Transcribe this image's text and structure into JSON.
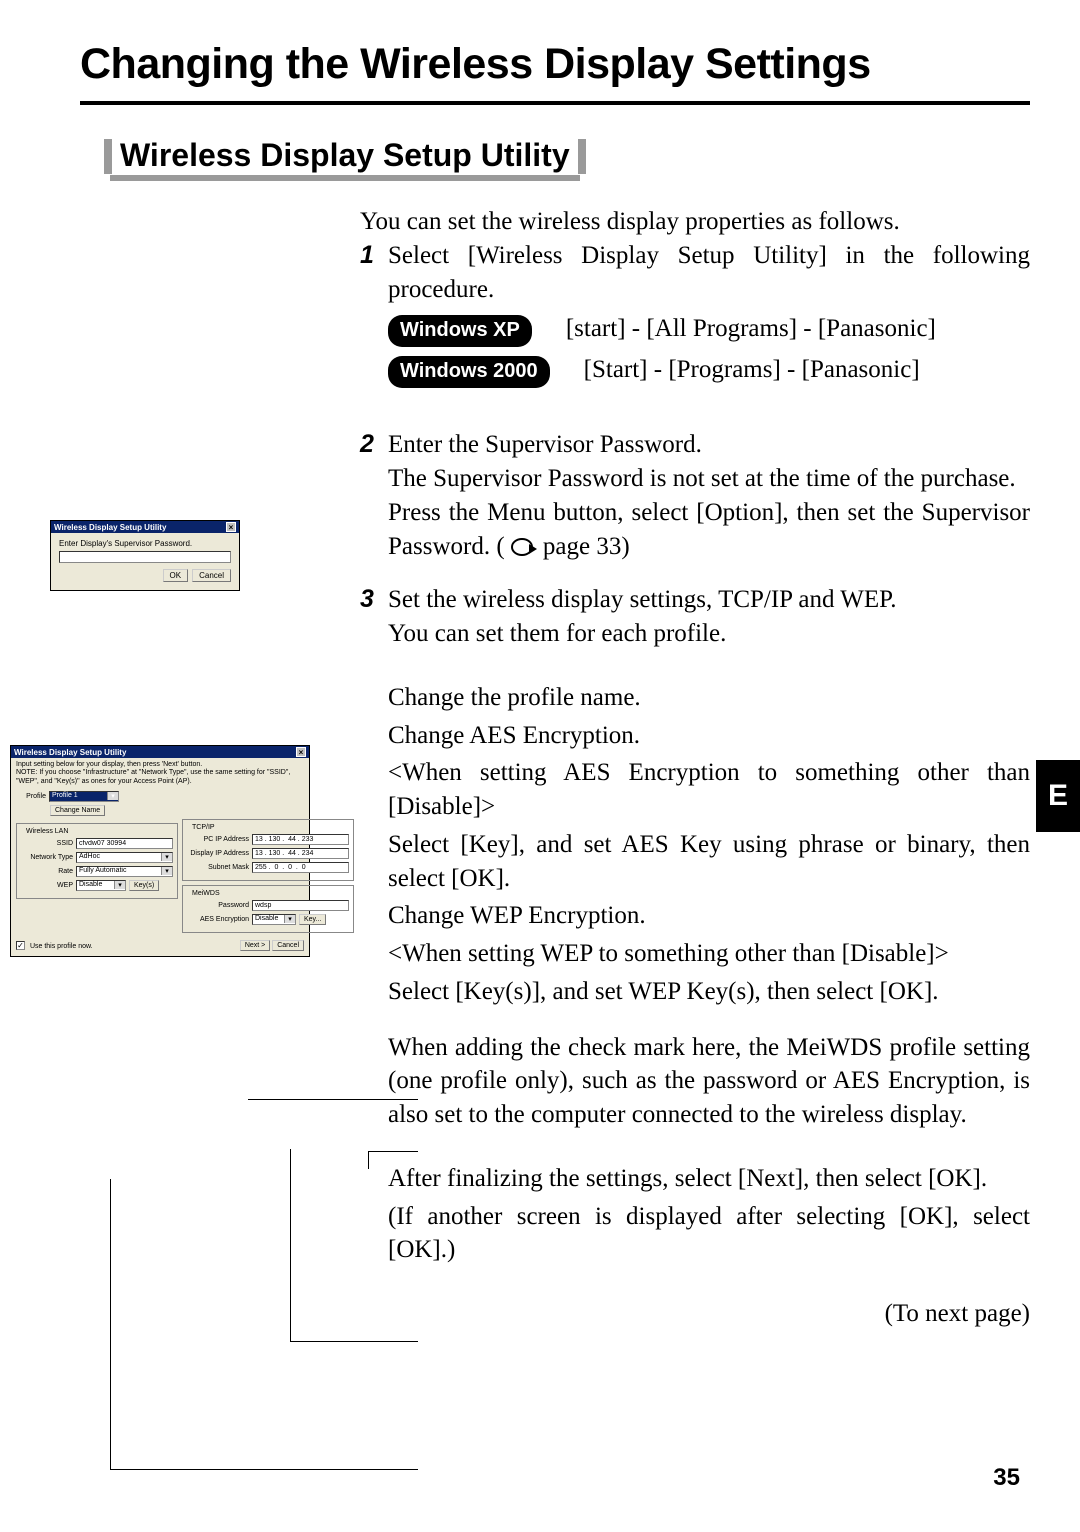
{
  "page": {
    "main_title": "Changing the Wireless Display Settings",
    "section_title": "Wireless Display Setup Utility",
    "tab_letter": "E",
    "page_number": "35",
    "to_next_page": "(To next page)"
  },
  "intro_text": "You can set the wireless display properties as follows.",
  "steps": {
    "s1": {
      "num": "1",
      "text": "Select [Wireless Display Setup Utility] in the following procedure.",
      "os_xp_label": "Windows XP",
      "os_xp_path": "[start] - [All Programs] - [Panasonic]",
      "os_2000_label": "Windows 2000",
      "os_2000_path": "[Start] - [Programs] - [Panasonic]"
    },
    "s2": {
      "num": "2",
      "l1": "Enter the Supervisor Password.",
      "l2": "The Supervisor Password is not set at the time of the purchase.",
      "l3a": "Press the Menu button, select [Option], then set the Supervisor Password.  (",
      "l3b": " page 33)"
    },
    "s3": {
      "num": "3",
      "l1": "Set the wireless display settings, TCP/IP and WEP.",
      "l2": "You can set them for each profile."
    }
  },
  "labels": {
    "profile": "Change the profile name.",
    "aes_title": "Change AES Encryption.",
    "aes_when": "<When setting AES Encryption to something other than [Disable]>",
    "aes_body": "Select [Key], and set AES Key using phrase or binary, then select [OK].",
    "wep_title": "Change WEP Encryption.",
    "wep_when": "<When setting WEP to something other than [Disable]>",
    "wep_body": "Select [Key(s)], and set WEP Key(s), then select [OK].",
    "check_body": "When adding the check mark here, the MeiWDS profile setting (one profile only), such as the password or AES Encryption, is also set to the computer connected to the wireless display.",
    "final1": "After finalizing the settings, select [Next], then select [OK].",
    "final2": "(If another screen is displayed after selecting [OK], select [OK].)"
  },
  "dlg_small": {
    "title": "Wireless Display Setup Utility",
    "prompt": "Enter Display's Supervisor Password.",
    "ok": "OK",
    "cancel": "Cancel"
  },
  "dlg_big": {
    "title": "Wireless Display Setup Utility",
    "note1": "Input setting below for your display, then press 'Next' button.",
    "note2": "NOTE: If you choose \"Infrastructure\" at \"Network Type\", use the same setting for \"SSID\", \"WEP\", and \"Key(s)\" as ones for your Access Point (AP).",
    "profile_label": "Profile",
    "profile_value": "Profile 1",
    "change_name_btn": "Change Name",
    "wlan_group": "Wireless LAN",
    "ssid_label": "SSID",
    "ssid_value": "cfvdw07 30994",
    "nettype_label": "Network Type",
    "nettype_value": "AdHoc",
    "rate_label": "Rate",
    "rate_value": "Fully Automatic",
    "wep_label": "WEP",
    "wep_value": "Disable",
    "keys_btn": "Key(s)",
    "tcpip_group": "TCP/IP",
    "pcip_label": "PC IP Address",
    "pcip_value": "13 . 130 .  44 . 233",
    "dispip_label": "Display IP Address",
    "dispip_value": "13 . 130 .  44 . 234",
    "subnet_label": "Subnet Mask",
    "subnet_value": "255 .  0  .  0  .  0",
    "meiwds_group": "MeiWDS",
    "password_label": "Password",
    "password_value": "wdsp",
    "aes_label": "AES Encryption",
    "aes_value": "Disable",
    "key_btn": "Key...",
    "checkbox_label": "Use this profile now.",
    "checkbox_checked": "✓",
    "next_btn": "Next >",
    "cancel_btn": "Cancel"
  }
}
